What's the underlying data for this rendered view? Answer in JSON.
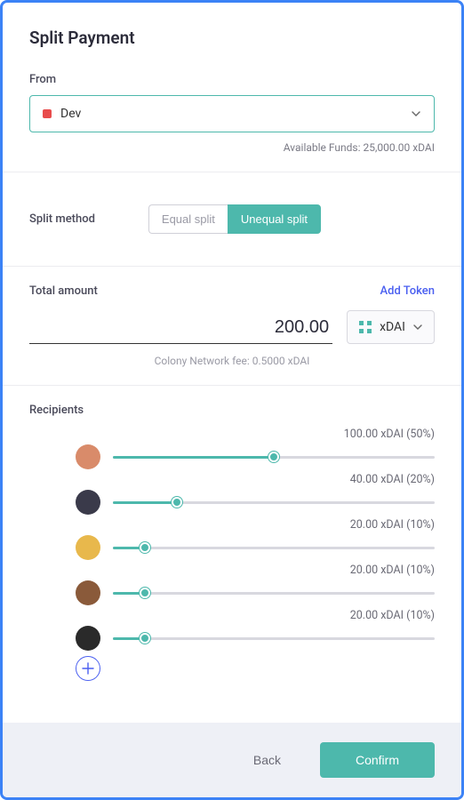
{
  "title": "Split Payment",
  "from": {
    "label": "From",
    "selected": "Dev",
    "availableLabel": "Available Funds: 25,000.00 xDAI"
  },
  "splitMethod": {
    "label": "Split method",
    "options": [
      "Equal split",
      "Unequal split"
    ],
    "active": 1
  },
  "totalAmount": {
    "label": "Total amount",
    "addTokenLabel": "Add Token",
    "value": "200.00",
    "tokenSymbol": "xDAI",
    "feeLabel": "Colony Network fee: 0.5000 xDAI"
  },
  "recipients": {
    "label": "Recipients",
    "items": [
      {
        "allocation": "100.00 xDAI (50%)",
        "percent": 50,
        "avatarColor": "#d98b6a"
      },
      {
        "allocation": "40.00 xDAI (20%)",
        "percent": 20,
        "avatarColor": "#3a3a4a"
      },
      {
        "allocation": "20.00 xDAI (10%)",
        "percent": 10,
        "avatarColor": "#e8b84c"
      },
      {
        "allocation": "20.00 xDAI (10%)",
        "percent": 10,
        "avatarColor": "#8a5a3a"
      },
      {
        "allocation": "20.00 xDAI (10%)",
        "percent": 10,
        "avatarColor": "#2a2a2a"
      }
    ]
  },
  "footer": {
    "back": "Back",
    "confirm": "Confirm"
  }
}
